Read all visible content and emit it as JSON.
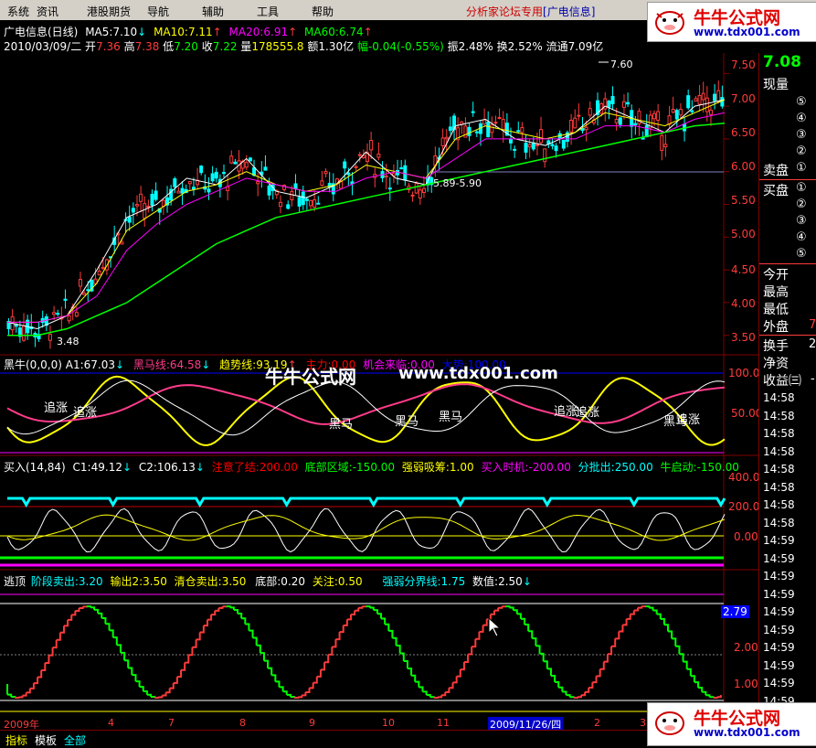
{
  "menu": {
    "items": [
      "系统",
      "资讯",
      "港股期货",
      "导航",
      "辅助",
      "工具",
      "帮助"
    ],
    "forum_text": "分析家论坛专用",
    "stock_tag": "[广电信息]"
  },
  "logo": {
    "title": "牛牛公式网",
    "url": "www.tdx001.com"
  },
  "header": {
    "stock": "广电信息(日线)",
    "ma": [
      {
        "label": "MA5:7.10",
        "color": "#ffffff"
      },
      {
        "label": "MA10:7.11",
        "color": "#ffff00"
      },
      {
        "label": "MA20:6.91",
        "color": "#ff00ff"
      },
      {
        "label": "MA60:6.74",
        "color": "#00ff00"
      }
    ],
    "date": "2010/03/09/二",
    "open_label": "开",
    "open": "7.36",
    "high_label": "高",
    "high": "7.38",
    "low_label": "低",
    "low": "7.20",
    "close_label": "收",
    "close": "7.22",
    "vol_label": "量",
    "vol": "178555.8",
    "amount": "额1.30亿",
    "change": "幅-0.04(-0.55%)",
    "amplitude": "振2.48%",
    "turnover": "换2.52%",
    "float": "流通7.09亿"
  },
  "price_axis": [
    "7.50",
    "7.00",
    "6.50",
    "6.00",
    "5.50",
    "5.00",
    "4.50",
    "4.00",
    "3.50"
  ],
  "annotations": {
    "high": "7.60",
    "low": "3.48",
    "range": "5.89-5.90"
  },
  "right_panel": {
    "price": "7.08",
    "current_label": "现量",
    "sell_label": "卖盘",
    "buy_label": "买盘",
    "levels_sell": [
      "⑤",
      "④",
      "③",
      "②",
      "①"
    ],
    "levels_buy": [
      "①",
      "②",
      "③",
      "④",
      "⑤"
    ],
    "stats": [
      "今开",
      "最高",
      "最低",
      "外盘",
      "换手",
      "净资",
      "收益㈢"
    ],
    "stats_values": [
      "",
      "",
      "",
      "7-",
      "2",
      "",
      "-"
    ],
    "times": [
      "14:58",
      "14:58",
      "14:58",
      "14:58",
      "14:58",
      "14:58",
      "14:58",
      "14:58",
      "14:59",
      "14:59",
      "14:59",
      "14:59",
      "14:59",
      "14:59",
      "14:59",
      "14:59",
      "14:59",
      "14:59",
      "14:59",
      "15:00"
    ]
  },
  "panel1": {
    "title": "黑牛(0,0,0)",
    "a1": "A1:67.03",
    "heima": "黑马线:64.58",
    "trend": "趋势线:93.19",
    "extra1": "主力:0.00",
    "extra2": "机会来临:0.00",
    "extra3": "大势:100.00",
    "labels": [
      "追涨",
      "追涨",
      "黑马",
      "黑马",
      "黑马",
      "追涨",
      "追涨",
      "黑马",
      "追涨"
    ],
    "axis": [
      "100.00",
      "50.00"
    ]
  },
  "watermark": {
    "title": "牛牛公式网",
    "url": "www.tdx001.com"
  },
  "panel2": {
    "title": "买入(14,84)",
    "c1": "C1:49.12",
    "c2": "C2:106.13",
    "notice": "注意了结:200.00",
    "bottom": "底部区域:-150.00",
    "absorb": "强弱吸筹:1.00",
    "buy": "买入时机:-200.00",
    "batch": "分批出:250.00",
    "bull": "牛启动:-150.00",
    "axis": [
      "400.00",
      "200.00",
      "0.00"
    ]
  },
  "panel3": {
    "title": "逃顶",
    "stage": "阶段卖出:3.20",
    "output": "输出2:3.50",
    "clear": "清仓卖出:3.50",
    "bottom": "底部:0.20",
    "watch": "关注:0.50",
    "divider": "强弱分界线:1.75",
    "value": "数值:2.50",
    "axis": [
      "2.79",
      "2.00",
      "1.00"
    ]
  },
  "months": [
    "2009年",
    "4",
    "7",
    "8",
    "9",
    "10",
    "11",
    "2009/11/26/四",
    "2",
    "3"
  ],
  "bottom_tabs": [
    "指标",
    "模板",
    "全部"
  ],
  "chart_data": {
    "type": "line",
    "title": "广电信息(日线)",
    "xlabel": "",
    "ylabel": "",
    "ylim": [
      3.3,
      7.7
    ],
    "series": [
      {
        "name": "MA5",
        "values": [
          3.7,
          3.6,
          3.8,
          4.5,
          5.3,
          5.5,
          5.9,
          5.8,
          6.2,
          5.7,
          5.6,
          5.8,
          6.3,
          5.9,
          5.8,
          6.7,
          6.8,
          6.5,
          6.4,
          6.6,
          7.0,
          6.8,
          6.6,
          7.0,
          7.1
        ]
      },
      {
        "name": "MA10",
        "values": [
          3.7,
          3.7,
          3.8,
          4.3,
          5.1,
          5.4,
          5.7,
          5.8,
          6.0,
          5.8,
          5.7,
          5.8,
          6.1,
          6.0,
          5.9,
          6.5,
          6.7,
          6.6,
          6.5,
          6.6,
          6.9,
          6.8,
          6.7,
          6.9,
          7.1
        ]
      },
      {
        "name": "MA20",
        "values": [
          3.7,
          3.7,
          3.8,
          4.1,
          4.8,
          5.2,
          5.5,
          5.7,
          5.9,
          5.8,
          5.7,
          5.7,
          5.9,
          6.0,
          5.9,
          6.2,
          6.5,
          6.5,
          6.5,
          6.5,
          6.7,
          6.7,
          6.6,
          6.8,
          6.9
        ]
      },
      {
        "name": "MA60",
        "values": [
          3.5,
          3.5,
          3.6,
          3.8,
          4.0,
          4.3,
          4.6,
          4.9,
          5.1,
          5.3,
          5.4,
          5.5,
          5.6,
          5.7,
          5.8,
          5.9,
          6.0,
          6.1,
          6.2,
          6.3,
          6.4,
          6.5,
          6.6,
          6.7,
          6.74
        ]
      }
    ]
  }
}
